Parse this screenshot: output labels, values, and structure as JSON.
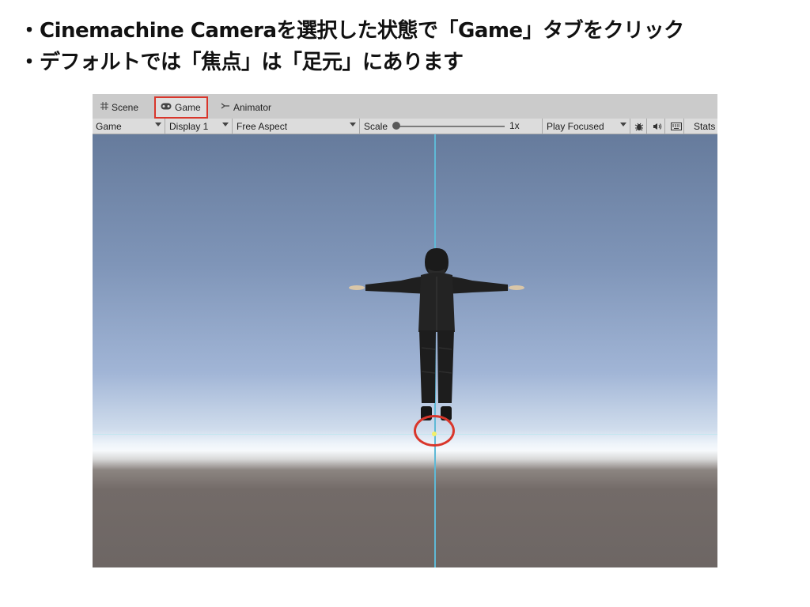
{
  "bullets": [
    "Cinemachine Cameraを選択した状態で「Game」タブをクリック",
    "デフォルトでは「焦点」は「足元」にあります"
  ],
  "bullet_marker": "・",
  "tabs": {
    "scene": "Scene",
    "game": "Game",
    "animator": "Animator"
  },
  "toolbar": {
    "game_view": "Game",
    "display": "Display 1",
    "aspect": "Free Aspect",
    "scale_label": "Scale",
    "scale_value": "1x",
    "play_mode": "Play Focused",
    "stats": "Stats"
  },
  "icons": {
    "scene": "grid-icon",
    "game": "gamepad-icon",
    "animator": "animator-icon",
    "bug": "bug-icon",
    "mute": "speaker-icon",
    "keyboard": "keyboard-icon"
  },
  "colors": {
    "highlight": "#d9362b",
    "crosshair": "#5fb9d6",
    "focus_point": "#f2ef6a"
  }
}
